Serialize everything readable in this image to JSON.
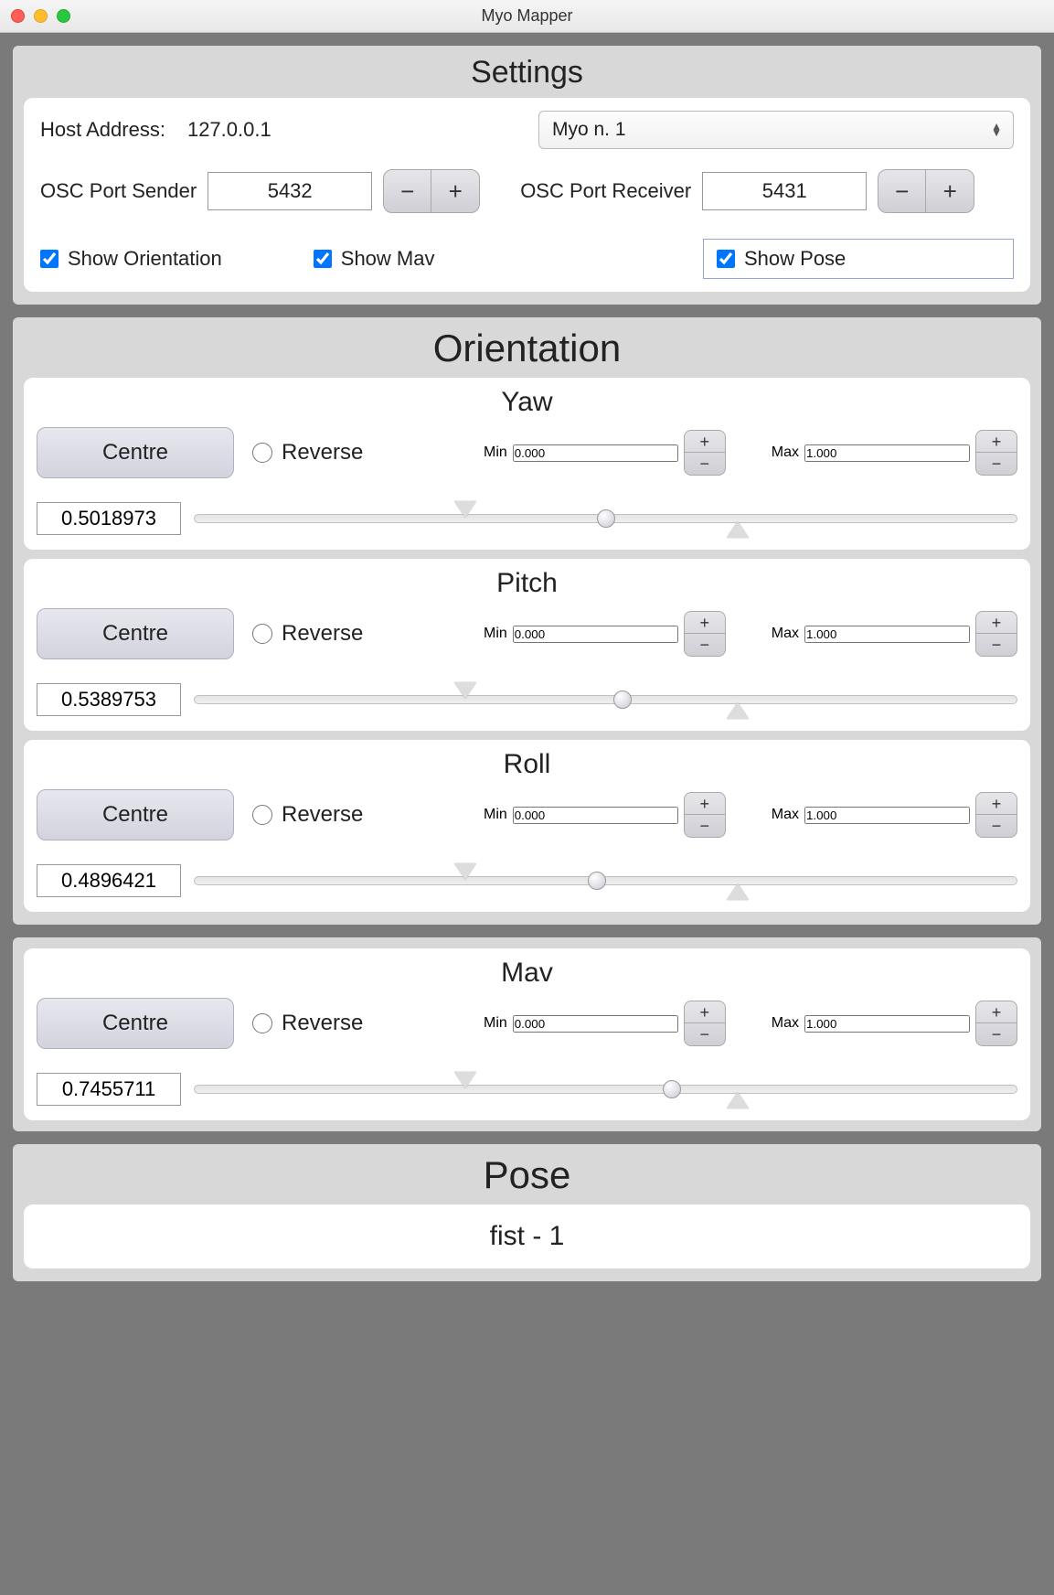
{
  "window": {
    "title": "Myo Mapper"
  },
  "settings": {
    "title": "Settings",
    "host_label": "Host Address:",
    "host_value": "127.0.0.1",
    "device_selected": "Myo n. 1",
    "osc_sender_label": "OSC Port Sender",
    "osc_sender_value": "5432",
    "osc_receiver_label": "OSC Port Receiver",
    "osc_receiver_value": "5431",
    "minus": "−",
    "plus": "+",
    "show_orientation": "Show Orientation",
    "show_mav": "Show Mav",
    "show_pose": "Show Pose"
  },
  "orientation": {
    "title": "Orientation",
    "yaw": {
      "title": "Yaw",
      "centre": "Centre",
      "reverse": "Reverse",
      "min_lbl": "Min",
      "min": "0.000",
      "max_lbl": "Max",
      "max": "1.000",
      "value": "0.5018973",
      "thumb_pct": 50,
      "mark_down_pct": 33,
      "mark_up_pct": 66
    },
    "pitch": {
      "title": "Pitch",
      "centre": "Centre",
      "reverse": "Reverse",
      "min_lbl": "Min",
      "min": "0.000",
      "max_lbl": "Max",
      "max": "1.000",
      "value": "0.5389753",
      "thumb_pct": 52,
      "mark_down_pct": 33,
      "mark_up_pct": 66
    },
    "roll": {
      "title": "Roll",
      "centre": "Centre",
      "reverse": "Reverse",
      "min_lbl": "Min",
      "min": "0.000",
      "max_lbl": "Max",
      "max": "1.000",
      "value": "0.4896421",
      "thumb_pct": 49,
      "mark_down_pct": 33,
      "mark_up_pct": 66
    }
  },
  "mav": {
    "title": "Mav",
    "centre": "Centre",
    "reverse": "Reverse",
    "min_lbl": "Min",
    "min": "0.000",
    "max_lbl": "Max",
    "max": "1.000",
    "value": "0.7455711",
    "thumb_pct": 58,
    "mark_down_pct": 33,
    "mark_up_pct": 66
  },
  "pose": {
    "title": "Pose",
    "value": "fist - 1"
  }
}
